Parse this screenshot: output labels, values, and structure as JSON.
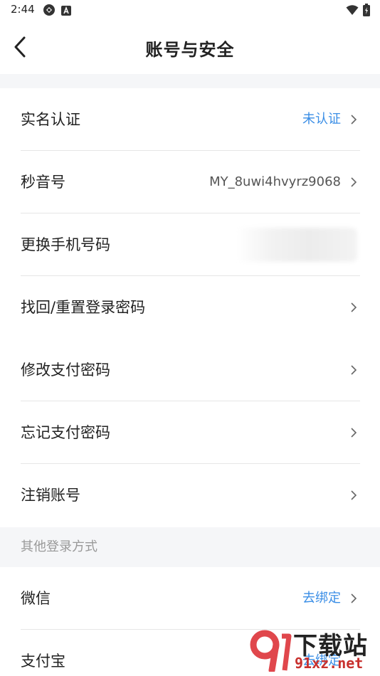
{
  "status_bar": {
    "time": "2:44",
    "icons_left": [
      "sync-icon",
      "app-a-icon"
    ],
    "icons_right": [
      "wifi-icon",
      "battery-charging-icon"
    ]
  },
  "header": {
    "title": "账号与安全",
    "back_icon": "chevron-left-icon"
  },
  "rows": [
    {
      "label": "实名认证",
      "value": "未认证",
      "value_color": "#3a8ee6"
    },
    {
      "label": "秒音号",
      "value": "MY_8uwi4hvyrz9068",
      "value_color": "#555555"
    },
    {
      "label": "更换手机号码",
      "value": "",
      "value_obscured": true
    },
    {
      "label": "找回/重置登录密码",
      "value": ""
    },
    {
      "label": "修改支付密码",
      "value": ""
    },
    {
      "label": "忘记支付密码",
      "value": ""
    },
    {
      "label": "注销账号",
      "value": ""
    }
  ],
  "other_login": {
    "header": "其他登录方式",
    "rows": [
      {
        "label": "微信",
        "value": "去绑定",
        "value_color": "#3a8ee6"
      },
      {
        "label": "支付宝",
        "value": "去绑定",
        "value_color": "#3a8ee6"
      }
    ]
  },
  "watermark": {
    "line1": "下载站",
    "line2": "91xz.net",
    "logo_color": "#e0474c"
  },
  "colors": {
    "accent_blue": "#3a8ee6",
    "band_background": "#f5f6f8",
    "divider": "#e6e6e6"
  }
}
